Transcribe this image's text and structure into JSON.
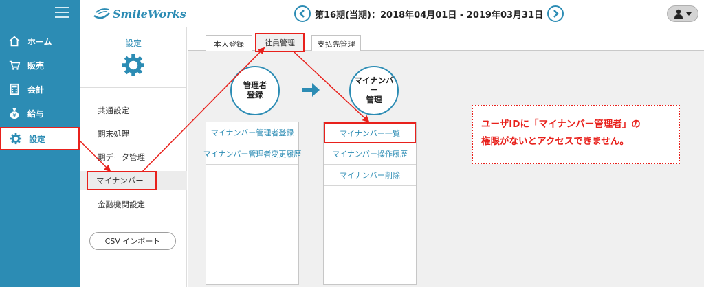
{
  "nav": {
    "items": [
      {
        "label": "ホーム",
        "icon": "home-icon"
      },
      {
        "label": "販売",
        "icon": "cart-icon"
      },
      {
        "label": "会計",
        "icon": "calculator-icon"
      },
      {
        "label": "給与",
        "icon": "money-bag-icon"
      },
      {
        "label": "設定",
        "icon": "gear-icon",
        "active": true
      }
    ]
  },
  "header": {
    "logo_text": "SmileWorks",
    "period_text": "第16期(当期)：2018年04月01日 - 2019年03月31日"
  },
  "subpanel": {
    "title": "設定",
    "items": [
      "共通設定",
      "期末処理",
      "期データ管理",
      "マイナンバー",
      "金融機関設定"
    ],
    "active_index": 3,
    "csv_button": "CSV インポート"
  },
  "tabs": [
    {
      "label": "本人登録"
    },
    {
      "label": "社員管理",
      "active": true
    },
    {
      "label": "支払先管理"
    }
  ],
  "flow": {
    "step1": {
      "line1": "管理者",
      "line2": "登録"
    },
    "step2": {
      "line1": "マイナンバー",
      "line2": "管理"
    },
    "box1": [
      "マイナンバー管理者登録",
      "マイナンバー管理者変更履歴"
    ],
    "box2": [
      "マイナンバー一覧",
      "マイナンバー操作履歴",
      "マイナンバー削除"
    ]
  },
  "notice": {
    "line1": "ユーザIDに「マイナンバー管理者」の",
    "line2": "権限がないとアクセスできません。"
  },
  "colors": {
    "accent": "#2c8cb4",
    "highlight": "#e8211c",
    "background": "#f0f0f0"
  }
}
